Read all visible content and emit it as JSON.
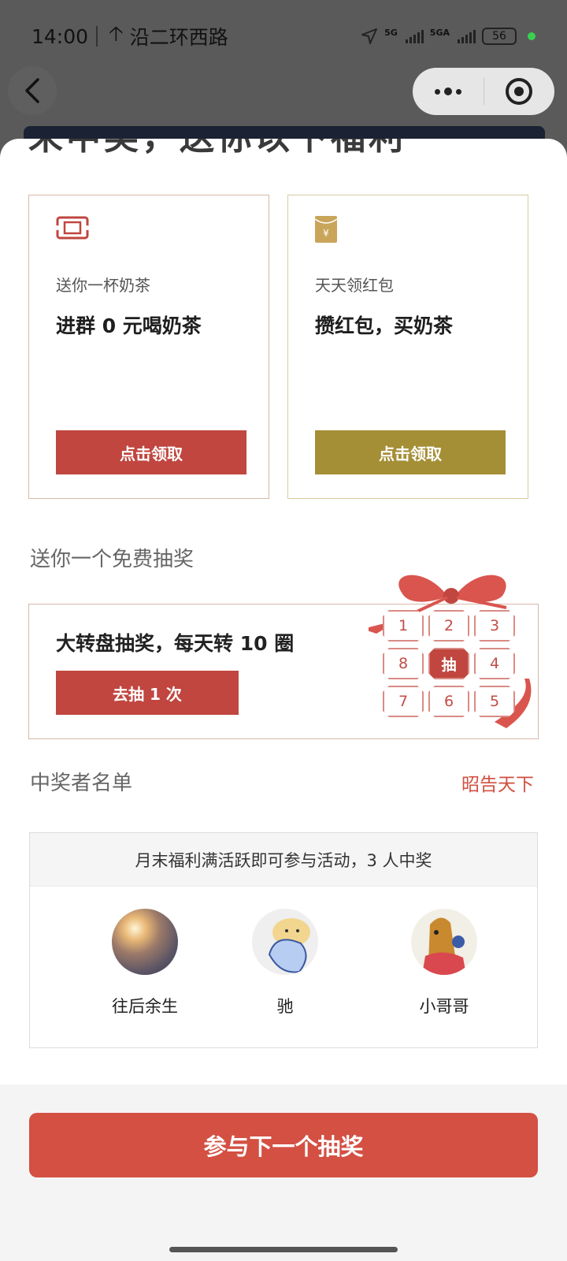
{
  "status": {
    "time": "14:00",
    "nav_text": "沿二环西路",
    "net1": "5G",
    "net2": "5GA",
    "battery": "56"
  },
  "header": {
    "peek_title": "未中奖，送你以下福利"
  },
  "cards": [
    {
      "subtitle": "送你一杯奶茶",
      "title": "进群 0 元喝奶茶",
      "button": "点击领取",
      "icon": "ticket-icon",
      "color": "#c0463f"
    },
    {
      "subtitle": "天天领红包",
      "title": "攒红包，买奶茶",
      "button": "点击领取",
      "icon": "red-envelope-icon",
      "color": "#a58f36"
    }
  ],
  "lottery": {
    "section_title": "送你一个免费抽奖",
    "title": "大转盘抽奖，每天转 10 圈",
    "button": "去抽 1 次",
    "grid": [
      "1",
      "2",
      "3",
      "8",
      "抽",
      "4",
      "7",
      "6",
      "5"
    ]
  },
  "winners": {
    "section_title": "中奖者名单",
    "link": "昭告天下",
    "notice": "月末福利满活跃即可参与活动，3 人中奖",
    "list": [
      {
        "name": "往后余生"
      },
      {
        "name": "驰"
      },
      {
        "name": "小哥哥"
      }
    ]
  },
  "footer": {
    "cta": "参与下一个抽奖"
  }
}
